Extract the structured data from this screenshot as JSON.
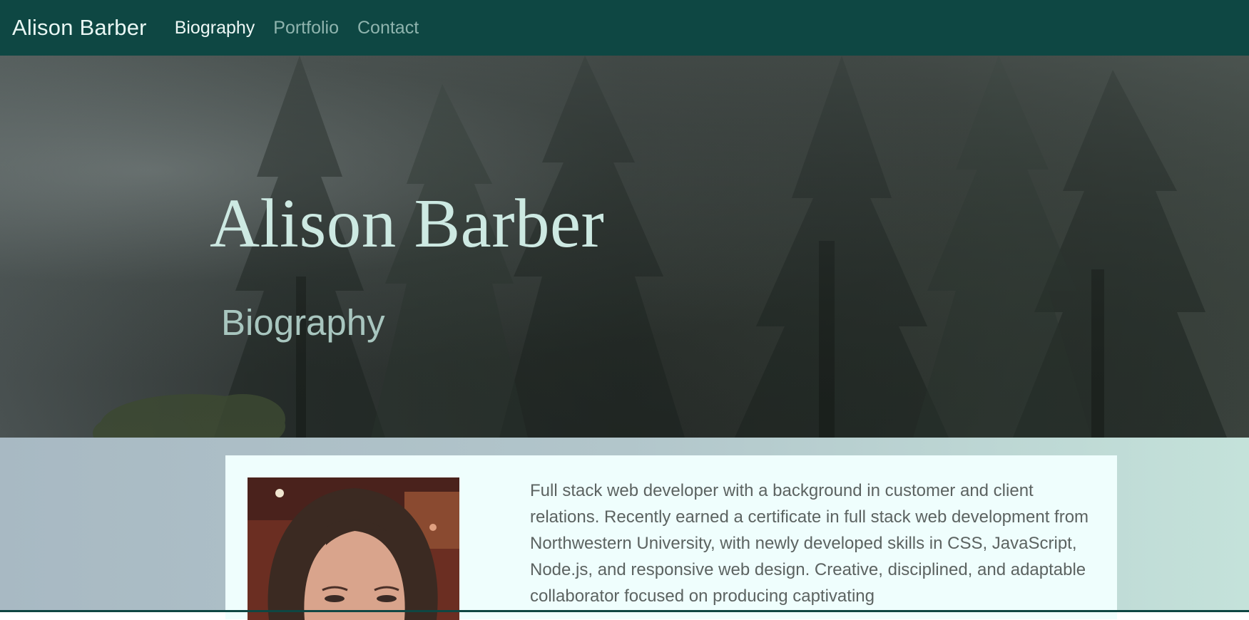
{
  "navbar": {
    "brand": "Alison Barber",
    "links": [
      {
        "label": "Biography",
        "active": true
      },
      {
        "label": "Portfolio",
        "active": false
      },
      {
        "label": "Contact",
        "active": false
      }
    ]
  },
  "hero": {
    "title": "Alison Barber",
    "subtitle": "Biography"
  },
  "bio": {
    "text": "Full stack web developer with a background in customer and client relations. Recently earned a certificate in full stack web development from Northwestern University, with newly developed skills in CSS, JavaScript, Node.js, and responsive web design. Creative, disciplined, and adaptable collaborator focused on producing captivating"
  },
  "colors": {
    "navbar_bg": "#0e4743",
    "hero_title": "#cde9e2",
    "card_bg": "#effefd",
    "nav_active": "#eef8f6",
    "nav_inactive": "#8fb4ae"
  }
}
